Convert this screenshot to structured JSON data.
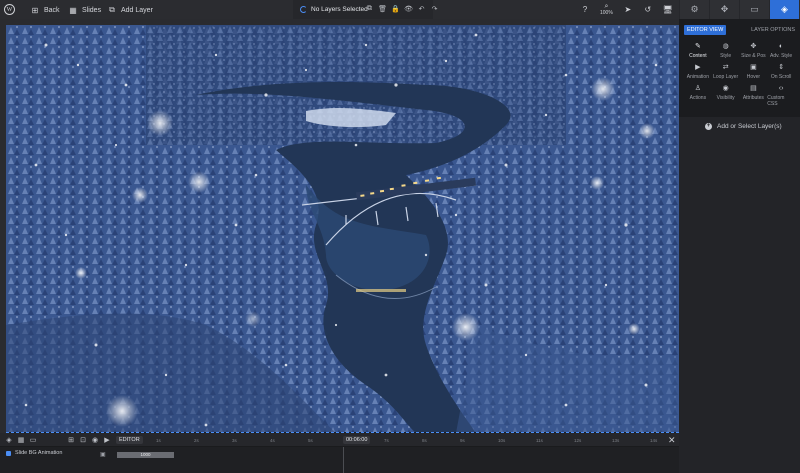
{
  "topbar": {
    "back_label": "Back",
    "slides_label": "Slides",
    "add_layer_label": "Add Layer",
    "status_label": "No Layers Selected",
    "zoom_label": "100%"
  },
  "panel": {
    "tab_editor_view": "EDITOR VIEW",
    "tab_layer_options": "LAYER OPTIONS",
    "options": [
      {
        "label": "Content",
        "icon": "pencil-icon",
        "glyph": "✎"
      },
      {
        "label": "Style",
        "icon": "palette-icon",
        "glyph": "◍"
      },
      {
        "label": "Size & Pos",
        "icon": "move-icon",
        "glyph": "✥"
      },
      {
        "label": "Adv. Style",
        "icon": "contrast-icon",
        "glyph": "◐"
      },
      {
        "label": "Animation",
        "icon": "play-icon",
        "glyph": "▶"
      },
      {
        "label": "Loop Layer",
        "icon": "loop-icon",
        "glyph": "⇄"
      },
      {
        "label": "Hover",
        "icon": "mouse-icon",
        "glyph": "▣"
      },
      {
        "label": "On Scroll",
        "icon": "scroll-icon",
        "glyph": "⇕"
      },
      {
        "label": "Actions",
        "icon": "joystick-icon",
        "glyph": "♙"
      },
      {
        "label": "Visibility",
        "icon": "eye-icon",
        "glyph": "◉"
      },
      {
        "label": "Attributes",
        "icon": "document-icon",
        "glyph": "▤"
      },
      {
        "label": "Custom CSS",
        "icon": "code-icon",
        "glyph": "‹›"
      }
    ],
    "add_select_label": "Add or Select Layer(s)"
  },
  "timeline": {
    "editor_tag": "EDITOR",
    "playhead_time": "00:06:00",
    "ticks": [
      "1s",
      "2s",
      "3s",
      "4s",
      "5s",
      "7s",
      "8s",
      "9s",
      "10s",
      "11s",
      "12s",
      "13s",
      "14s"
    ],
    "layer_label": "Slide BG Animation",
    "bar_label": "1000"
  },
  "colors": {
    "accent": "#2e6fd8",
    "panel_bg": "#232428",
    "topbar_bg": "#2b2c30"
  }
}
